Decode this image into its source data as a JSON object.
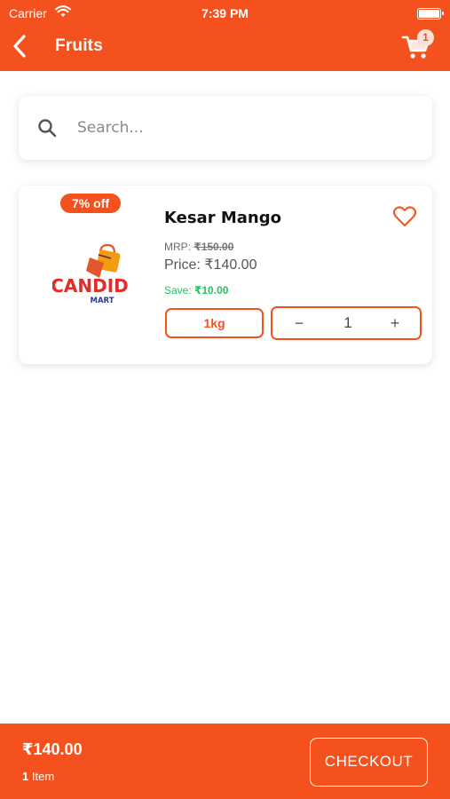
{
  "status_bar": {
    "carrier": "Carrier",
    "time": "7:39 PM"
  },
  "header": {
    "title": "Fruits",
    "cart_count": "1"
  },
  "search": {
    "placeholder": "Search..."
  },
  "product": {
    "discount_label": "7% off",
    "brand_logo_text": [
      "CANDID",
      "MART"
    ],
    "name": "Kesar Mango",
    "mrp_label": "MRP:",
    "mrp_value": "₹150.00",
    "price_label": "Price:",
    "price_value": "₹140.00",
    "save_label": "Save:",
    "save_value": "₹10.00",
    "weight": "1kg",
    "quantity": "1",
    "minus_symbol": "−",
    "plus_symbol": "+"
  },
  "footer": {
    "total": "₹140.00",
    "item_count": "1",
    "item_label": "Item",
    "checkout_label": "CHECKOUT"
  },
  "colors": {
    "accent": "#f4511e",
    "save_green": "#22c55e",
    "text_dark": "#111111"
  }
}
